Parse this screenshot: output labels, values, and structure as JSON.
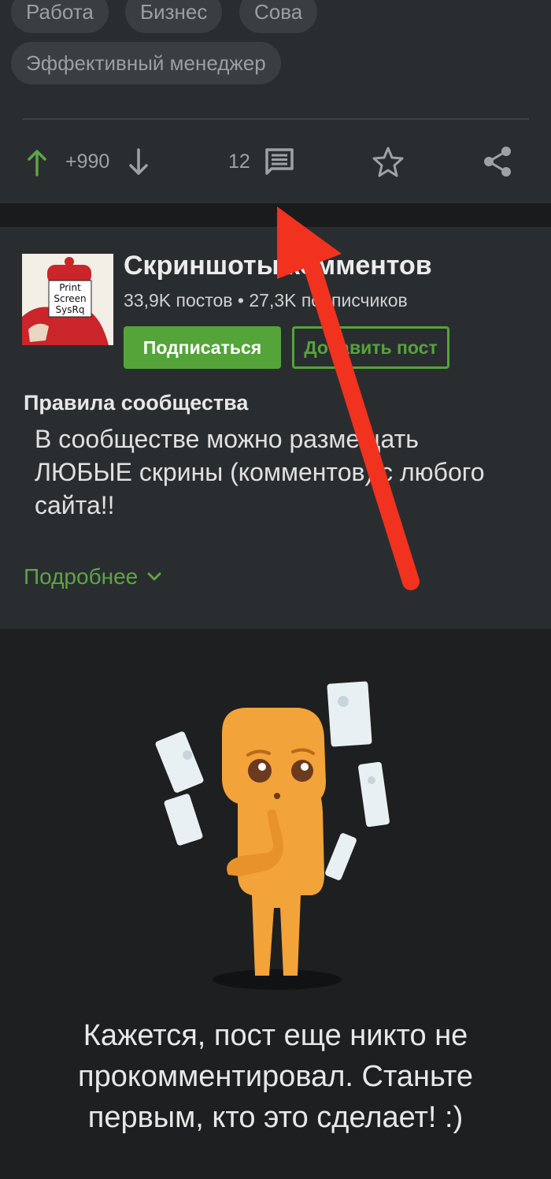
{
  "tags": [
    {
      "label": "Работа"
    },
    {
      "label": "Бизнес"
    },
    {
      "label": "Сова"
    },
    {
      "label": "Эффективный менеджер"
    }
  ],
  "actions": {
    "rating": "+990",
    "comments_count": "12"
  },
  "community": {
    "title": "Скриншоты комментов",
    "stats": "33,9K постов • 27,3K подписчиков",
    "subscribe_label": "Подписаться",
    "add_post_label": "Добавить пост",
    "rules_title": "Правила сообщества",
    "rules_text": "В сообществе можно размещать ЛЮБЫЕ скрины (комментов) с любого сайта!!",
    "more_label": "Подробнее",
    "avatar_text": [
      "Print",
      "Screen",
      "SysRq"
    ]
  },
  "empty_state": {
    "message": "Кажется, пост еще никто не прокомментировал. Станьте первым, кто это сделает! :)"
  },
  "colors": {
    "accent_green": "#54a43a",
    "annotation_red": "#f0321e"
  },
  "icons": [
    "arrow-up-icon",
    "arrow-down-icon",
    "comment-icon",
    "star-icon",
    "share-icon",
    "chevron-down-icon"
  ]
}
